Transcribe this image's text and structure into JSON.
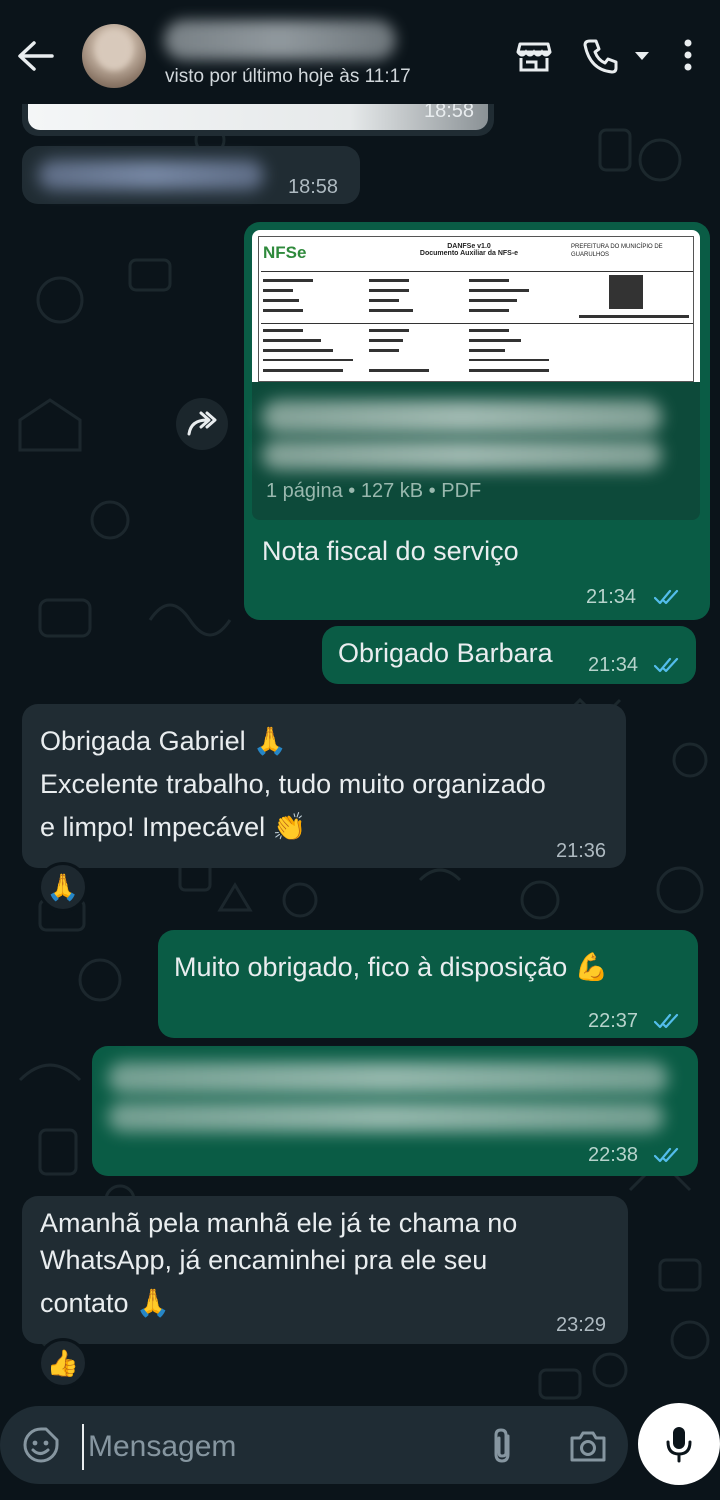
{
  "header": {
    "last_seen": "visto por último hoje às 11:17"
  },
  "messages": {
    "m1_time": "18:58",
    "m2_time": "18:58",
    "doc": {
      "pdf_brand": "NFSe",
      "pdf_header_title": "DANFSe v1.0",
      "pdf_header_subtitle": "Documento Auxiliar da NFS-e",
      "pdf_municipality": "PREFEITURA DO MUNICÍPIO DE GUARULHOS",
      "meta": "1 página • 127 kB • PDF",
      "caption": "Nota fiscal do serviço",
      "time": "21:34"
    },
    "m4_text": "Obrigado Barbara",
    "m4_time": "21:34",
    "m5_line1": "Obrigada Gabriel 🙏",
    "m5_line2": "Excelente trabalho, tudo muito organizado",
    "m5_line3": "e limpo! Impecável 👏",
    "m5_time": "21:36",
    "m5_reaction": "🙏",
    "m6_text": "Muito obrigado, fico à disposição 💪",
    "m6_time": "22:37",
    "m7_time": "22:38",
    "m8_line1": "Amanhã pela manhã ele já te chama no",
    "m8_line2": "WhatsApp, já encaminhei pra ele seu",
    "m8_line3": "contato 🙏",
    "m8_time": "23:29",
    "m8_reaction": "👍"
  },
  "input": {
    "placeholder": "Mensagem"
  },
  "colors": {
    "background": "#0b141a",
    "incoming_bubble": "#202c33",
    "outgoing_bubble": "#0a5c45",
    "read_ticks": "#53bdeb"
  }
}
